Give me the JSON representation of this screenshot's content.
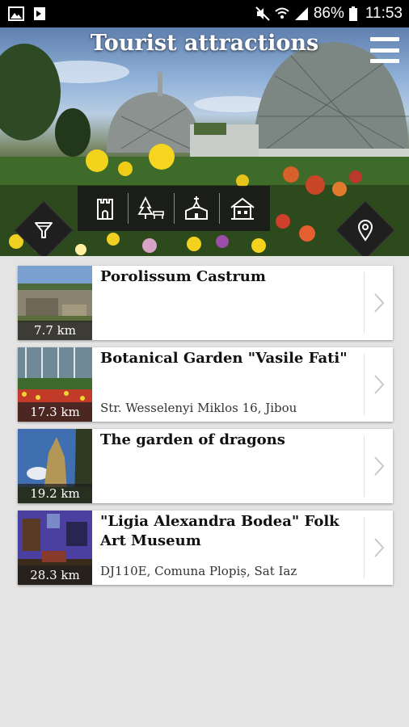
{
  "status_bar": {
    "battery": "86%",
    "time": "11:53"
  },
  "header": {
    "title": "Tourist attractions"
  },
  "attractions": [
    {
      "name": "Porolissum Castrum",
      "distance": "7.7 km",
      "address": ""
    },
    {
      "name": "Botanical Garden \"Vasile Fati\"",
      "distance": "17.3 km",
      "address": "Str. Wesselenyi Miklos 16, Jibou"
    },
    {
      "name": "The garden of dragons",
      "distance": "19.2 km",
      "address": ""
    },
    {
      "name": "\"Ligia Alexandra Bodea\" Folk Art Museum",
      "distance": "28.3 km",
      "address": "DJ110E, Comuna Plopiș, Sat Iaz"
    }
  ],
  "icons": {
    "filter": "filter-icon",
    "location": "location-pin-icon",
    "categories": [
      "castle-icon",
      "park-icon",
      "church-icon",
      "museum-icon"
    ],
    "menu": "hamburger-menu-icon"
  }
}
